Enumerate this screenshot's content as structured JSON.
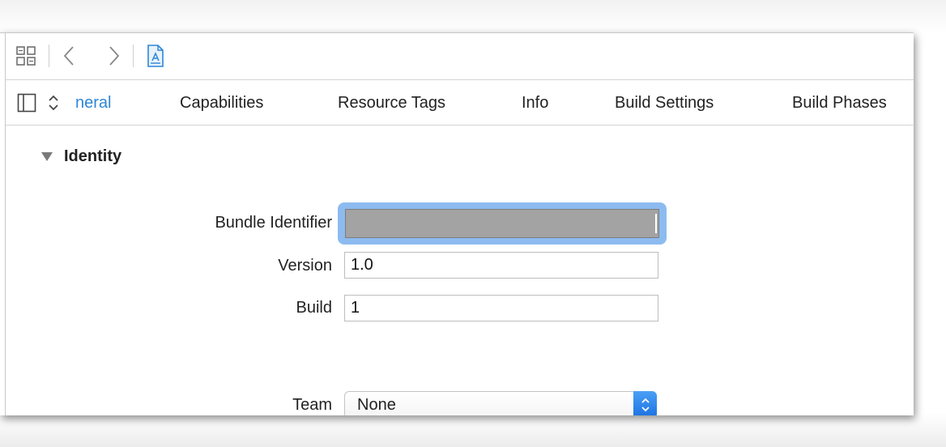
{
  "toolbar": {
    "grid_icon": "related-items-grid-icon",
    "back_icon": "chevron-left-icon",
    "forward_icon": "chevron-right-icon",
    "file_icon": "project-file-icon",
    "accent": "#2e86d6"
  },
  "tabbar": {
    "sidebar_toggle_icon": "sidebar-toggle-icon",
    "target_selector_icon": "up-down-chevron-icon",
    "tabs": [
      {
        "label": "neral",
        "active": true
      },
      {
        "label": "Capabilities",
        "active": false
      },
      {
        "label": "Resource Tags",
        "active": false
      },
      {
        "label": "Info",
        "active": false
      },
      {
        "label": "Build Settings",
        "active": false
      },
      {
        "label": "Build Phases",
        "active": false
      }
    ]
  },
  "identity": {
    "title": "Identity",
    "bundle_identifier": {
      "label": "Bundle Identifier",
      "value": ""
    },
    "version": {
      "label": "Version",
      "value": "1.0"
    },
    "build": {
      "label": "Build",
      "value": "1"
    },
    "team": {
      "label": "Team",
      "value": "None"
    }
  },
  "colors": {
    "focus_ring": "#8dbbf0",
    "redacted_fill": "#a3a3a3",
    "popup_button_blue": "#1a6fe0"
  }
}
